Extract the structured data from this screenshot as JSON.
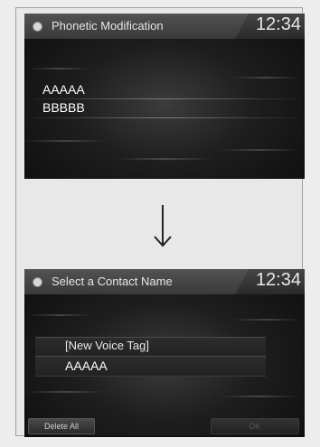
{
  "screen1": {
    "title": "Phonetic Modification",
    "time": "12:34",
    "items": [
      "AAAAA",
      "BBBBB"
    ]
  },
  "screen2": {
    "title": "Select a Contact Name",
    "time": "12:34",
    "items": [
      "[New Voice Tag]",
      "AAAAA"
    ],
    "footer": {
      "delete_all": "Delete All",
      "ok": "OK"
    }
  },
  "icons": {
    "back": "back-icon",
    "transition": "down-arrow-icon"
  }
}
